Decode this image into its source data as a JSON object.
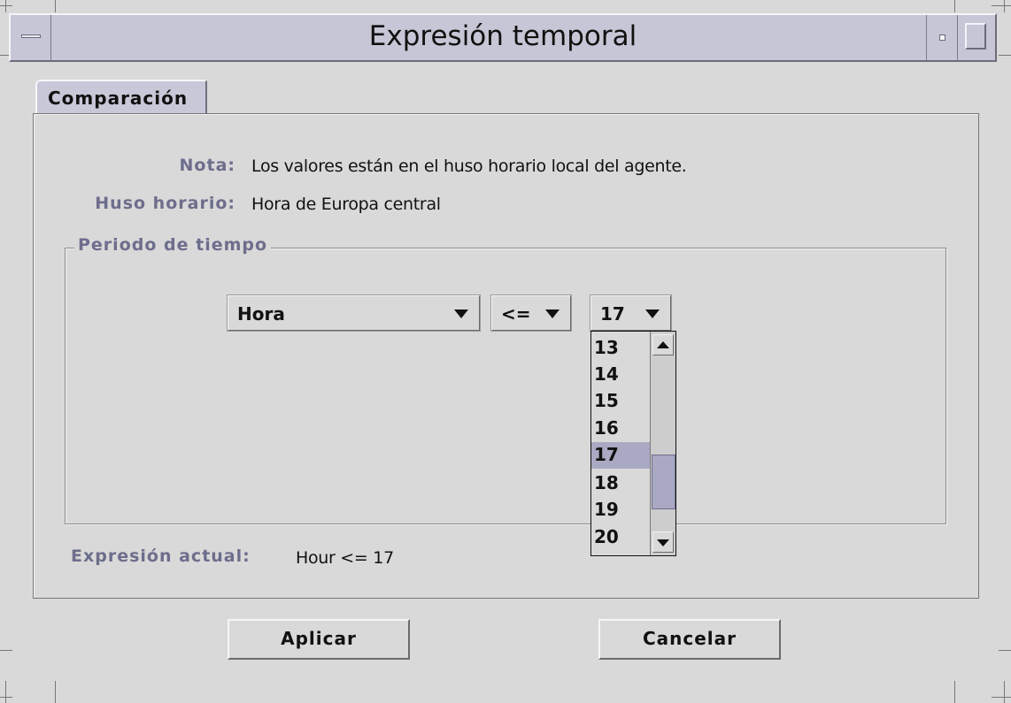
{
  "window": {
    "title": "Expresión temporal"
  },
  "tabs": [
    {
      "label": "Comparación",
      "active": true
    }
  ],
  "info": {
    "note_label": "Nota:",
    "note_value": "Los valores están en el huso horario local del agente.",
    "timezone_label": "Huso horario:",
    "timezone_value": "Hora de Europa central"
  },
  "period": {
    "group_title": "Periodo de tiempo",
    "field_select": {
      "selected": "Hora"
    },
    "operator_select": {
      "selected": "<="
    },
    "value_select": {
      "selected": "17",
      "visible_options": [
        "13",
        "14",
        "15",
        "16",
        "17",
        "18",
        "19",
        "20"
      ],
      "highlighted": "17"
    }
  },
  "current_expression": {
    "label": "Expresión actual:",
    "value": "Hour <= 17"
  },
  "buttons": {
    "apply": "Aplicar",
    "cancel": "Cancelar"
  },
  "colors": {
    "background": "#d9d9d9",
    "titlebar": "#c6c6d6",
    "label_text": "#6d6d8c",
    "selection": "#a9a9c3"
  },
  "icons": {
    "window_menu": "window-menu-icon",
    "minimize": "minimize-icon",
    "maximize": "maximize-icon",
    "dropdown": "chevron-down-icon",
    "scroll_up": "scroll-up-arrow-icon",
    "scroll_down": "scroll-down-arrow-icon"
  }
}
